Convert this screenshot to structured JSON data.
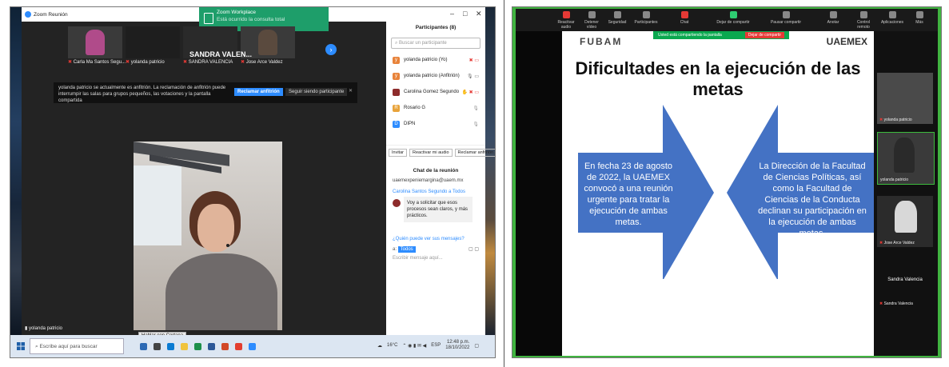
{
  "left": {
    "window_title": "Zoom Reunión",
    "toast": {
      "title": "Zoom Workplace",
      "subtitle": "Está ocurrido la consulta total"
    },
    "thumbnails": [
      {
        "name": "Carla Ma Santos Segu..."
      },
      {
        "name": "yolanda patricio"
      },
      {
        "name": "SANDRA VALENCIA"
      },
      {
        "name": "Jose Arce Valdez"
      }
    ],
    "speaker_banner": "SANDRA VALEN...",
    "notification": {
      "text": "yolanda patricio se actualmente es anfitrión. La reclamación de anfitrión puede interrumpir las salas para grupos pequeños, las votaciones y la pantalla compartida",
      "claim_button": "Reclamar anfitrión",
      "keep_button": "Seguir siendo participante"
    },
    "active_video_name": "yolanda patricio",
    "tooltip": "Hablar con Cortana",
    "panel": {
      "title": "Participantes (8)",
      "search_placeholder": "Buscar un participante",
      "participants": [
        {
          "name": "yolanda patricio (Yo)",
          "initial": "y",
          "color": "#e8833a"
        },
        {
          "name": "yolanda patricio (Anfitrión)",
          "initial": "y",
          "color": "#e8833a"
        },
        {
          "name": "Carolina Gomez Segundo",
          "initial": "",
          "color": "#8d2b2b"
        },
        {
          "name": "Rosario G",
          "initial": "R",
          "color": "#e8a33a"
        },
        {
          "name": "DIPN",
          "initial": "D",
          "color": "#2d8cff"
        }
      ],
      "buttons": [
        "Invitar",
        "Reactivar mi audio",
        "Reclamar anfitrión"
      ],
      "chat_title": "Chat de la reunión",
      "chat_email": "uaemexpeniemargina@uaem.mx",
      "chat_from": "Carolina Santos Segundo a Todos",
      "chat_message": "Voy a solicitar que esos procesos sean claros, y más prácticos.",
      "chat_who": "¿Quién puede ver sus mensajes?",
      "to_label": "Todos",
      "input_placeholder": "Escribir mensaje aquí..."
    },
    "taskbar": {
      "search": "Escribe aquí para buscar",
      "weather": "16°C",
      "lang": "ESP",
      "time": "12:48 p.m.",
      "date": "18/10/2022"
    }
  },
  "right": {
    "toolbar": [
      "Reactivar audio",
      "Detener vídeo",
      "Seguridad",
      "Participantes",
      "Chat",
      "Dejar de compartir",
      "Pausar compartir",
      "Anotar",
      "Control remoto",
      "Aplicaciones",
      "Más"
    ],
    "share_bar": {
      "text": "Usted está compartiendo la pantalla",
      "stop": "Dejar de compartir"
    },
    "slide": {
      "logo_left": "FUBAM",
      "logo_right": "UAEMEX",
      "title": "Dificultades en la ejecución de las metas",
      "left_arrow_text": "En fecha 23 de agosto de 2022, la UAEMEX convocó a una reunión urgente para tratar la ejecución de ambas metas.",
      "right_arrow_text": "La Dirección de la Facultad de Ciencias Políticas, así como la Facultad de Ciencias de la Conducta declinan su participación en la ejecución de ambas metas.",
      "arrow_color": "#4472c4"
    },
    "gallery": [
      {
        "name": "yolanda patricio"
      },
      {
        "name": "yolanda patricio"
      },
      {
        "name": "Jose Arce Valdez"
      },
      {
        "name": "Sandra Valencia",
        "label": "Sandra Valencia"
      }
    ]
  }
}
